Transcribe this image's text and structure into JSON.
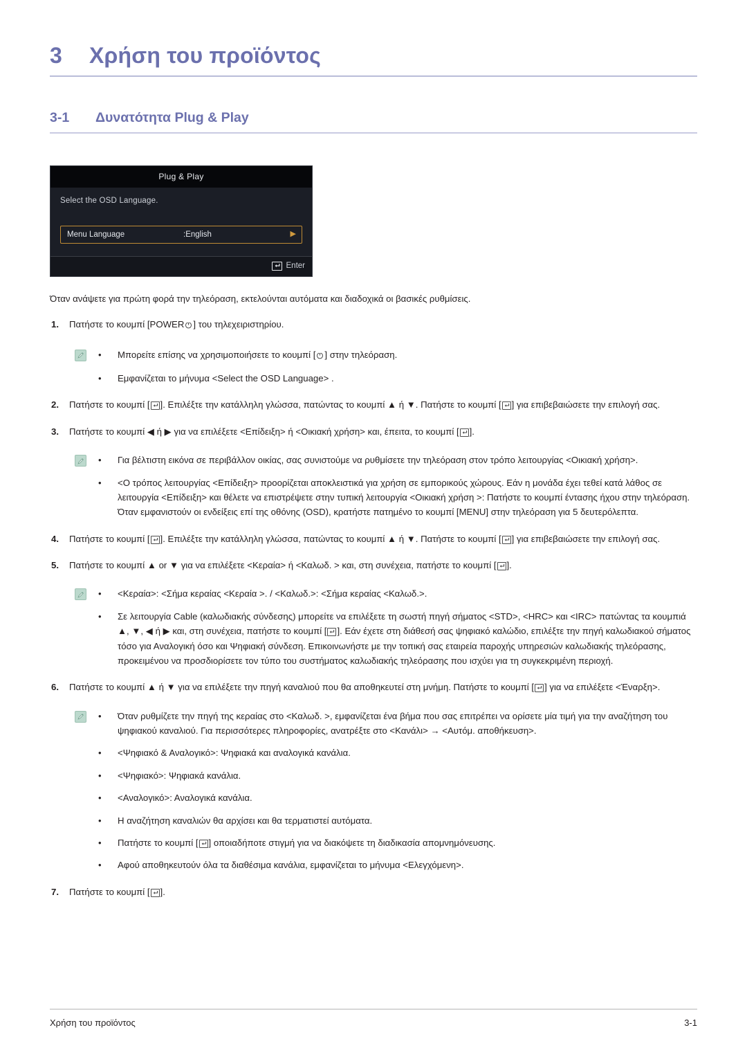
{
  "chapter": {
    "number": "3",
    "title": "Χρήση του προϊόντος"
  },
  "section": {
    "number": "3-1",
    "title": "Δυνατότητα Plug & Play"
  },
  "osd": {
    "title": "Plug & Play",
    "subtitle": "Select the OSD Language.",
    "row_label": "Menu Language",
    "row_value": ":English",
    "row_arrow": "▶",
    "footer_label": "Enter",
    "border_color": "#c08b34"
  },
  "intro": "Όταν ανάψετε για πρώτη φορά την τηλεόραση, εκτελούνται αυτόματα και διαδοχικά οι βασικές ρυθμίσεις.",
  "steps": {
    "s1_num": "1.",
    "s1_a": "Πατήστε το κουμπί [POWER",
    "s1_b": "] του τηλεχειριστηρίου.",
    "s2_num": "2.",
    "s2_a": "Πατήστε το κουμπί [",
    "s2_b": "]. Επιλέξτε την κατάλληλη γλώσσα, πατώντας το κουμπί ▲ ή ▼. Πατήστε το κουμπί [",
    "s2_c": "] για επιβεβαιώσετε την επιλογή σας.",
    "s3_num": "3.",
    "s3_a": "Πατήστε το κουμπί ◀ ή ▶ για να επιλέξετε <Επίδειξη> ή <Οικιακή χρήση> και, έπειτα, το κουμπί [",
    "s3_b": "].",
    "s4_num": "4.",
    "s4_a": "Πατήστε το κουμπί [",
    "s4_b": "]. Επιλέξτε την κατάλληλη γλώσσα, πατώντας το κουμπί ▲ ή ▼. Πατήστε το κουμπί [",
    "s4_c": "] για επιβεβαιώσετε την επιλογή σας.",
    "s5_num": "5.",
    "s5_a": "Πατήστε το κουμπί ▲ or ▼ για να επιλέξετε <Κεραία> ή <Καλωδ. > και, στη συνέχεια, πατήστε το κουμπί [",
    "s5_b": "].",
    "s6_num": "6.",
    "s6_a": "Πατήστε το κουμπί ▲ ή ▼ για να επιλέξετε την πηγή καναλιού που θα αποθηκευτεί στη μνήμη. Πατήστε το κουμπί [",
    "s6_b": "] για να επιλέξετε <Έναρξη>.",
    "s7_num": "7.",
    "s7_a": "Πατήστε το κουμπί [",
    "s7_b": "]."
  },
  "notes": {
    "bullet": "•",
    "n1_a": "Μπορείτε επίσης να χρησιμοποιήσετε το κουμπί [",
    "n1_b": "] στην τηλεόραση.",
    "n2": "Εμφανίζεται το μήνυμα <Select the OSD Language> .",
    "n3": "Για βέλτιστη εικόνα σε περιβάλλον οικίας, σας συνιστούμε να ρυθμίσετε την τηλεόραση στον τρόπο λειτουργίας <Οικιακή χρήση>.",
    "n4": "<Ο τρόπος λειτουργίας <Επίδειξη> προορίζεται αποκλειστικά για χρήση σε εμπορικούς χώρους. Εάν η μονάδα έχει τεθεί κατά λάθος σε λειτουργία <Επίδειξη> και θέλετε να επιστρέψετε στην τυπική λειτουργία <Οικιακή χρήση >: Πατήστε το κουμπί έντασης ήχου στην τηλεόραση. Όταν εμφανιστούν οι ενδείξεις επί της οθόνης (OSD), κρατήστε πατημένο το κουμπί [MENU] στην τηλεόραση για 5 δευτερόλεπτα.",
    "n5": "<Κεραία>: <Σήμα κεραίας <Κεραία >. / <Καλωδ.>: <Σήμα κεραίας <Καλωδ.>.",
    "n6_a": "Σε λειτουργία Cable (καλωδιακής σύνδεσης) μπορείτε να επιλέξετε τη σωστή πηγή σήματος <STD>, <HRC> και <IRC> πατώντας τα κουμπιά ▲, ▼, ◀ ή ▶ και, στη συνέχεια, πατήστε το κουμπί [",
    "n6_b": "]. Εάν έχετε στη διάθεσή σας ψηφιακό καλώδιο, επιλέξτε την πηγή καλωδιακού σήματος τόσο για Αναλογική όσο και Ψηφιακή σύνδεση. Επικοινωνήστε με την τοπική σας εταιρεία παροχής υπηρεσιών καλωδιακής τηλεόρασης, προκειμένου να προσδιορίσετε τον τύπο του συστήματος καλωδιακής τηλεόρασης που ισχύει για τη συγκεκριμένη περιοχή.",
    "n7": "Όταν ρυθμίζετε την πηγή της κεραίας στο <Καλωδ. >, εμφανίζεται ένα βήμα που σας επιτρέπει να ορίσετε μία τιμή για την αναζήτηση του ψηφιακού καναλιού. Για περισσότερες πληροφορίες, ανατρέξτε στο <Κανάλι> → <Αυτόμ. αποθήκευση>.",
    "n8": "<Ψηφιακό & Αναλογικό>: Ψηφιακά και αναλογικά κανάλια.",
    "n9": "<Ψηφιακό>: Ψηφιακά κανάλια.",
    "n10": "<Αναλογικό>: Αναλογικά κανάλια.",
    "n11": "Η αναζήτηση καναλιών θα αρχίσει και θα τερματιστεί αυτόματα.",
    "n12_a": "Πατήστε το κουμπί [",
    "n12_b": "] οποιαδήποτε στιγμή για να διακόψετε τη διαδικασία απομνημόνευσης.",
    "n13": "Αφού αποθηκευτούν όλα τα διαθέσιμα κανάλια, εμφανίζεται το μήνυμα <Ελεγχόμενη>."
  },
  "footer": {
    "left": "Χρήση του προϊόντος",
    "right": "3-1"
  },
  "colors": {
    "heading": "#6b70ad",
    "rule": "#b9bcd8",
    "note_icon_bg": "#bcd9cd"
  }
}
